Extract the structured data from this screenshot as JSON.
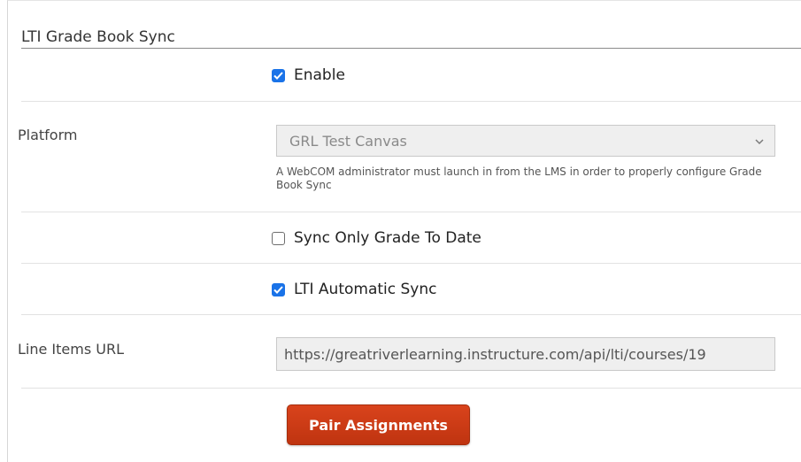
{
  "section": {
    "title": "LTI Grade Book Sync"
  },
  "enable": {
    "label": "Enable",
    "checked": true
  },
  "platform": {
    "label": "Platform",
    "selected": "GRL Test Canvas",
    "help": "A WebCOM administrator must launch in from the LMS in order to properly configure Grade Book Sync"
  },
  "sync_only": {
    "label": "Sync Only Grade To Date",
    "checked": false
  },
  "auto_sync": {
    "label": "LTI Automatic Sync",
    "checked": true
  },
  "line_items": {
    "label": "Line Items URL",
    "value": "https://greatriverlearning.instructure.com/api/lti/courses/19"
  },
  "actions": {
    "pair_label": "Pair Assignments"
  },
  "colors": {
    "checkbox_accent": "#1a73e8",
    "button": "#cc3b16"
  }
}
